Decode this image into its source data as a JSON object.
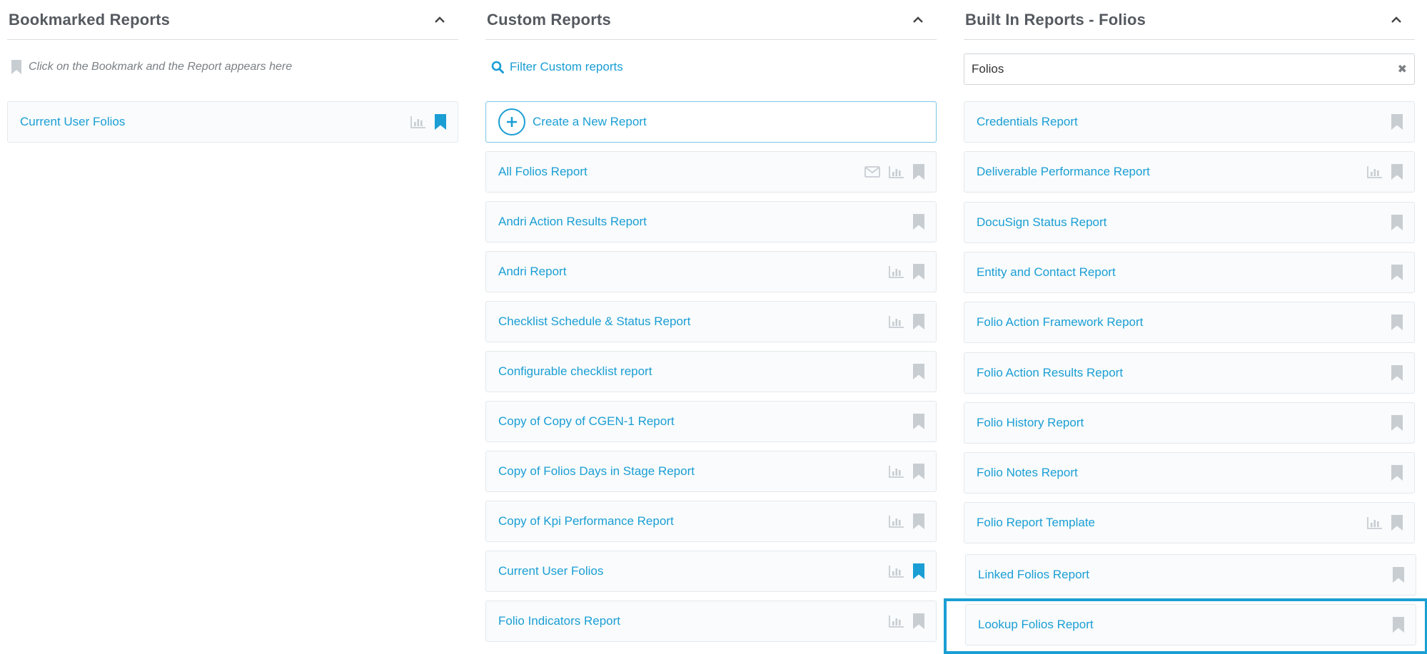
{
  "bookmarked": {
    "title": "Bookmarked Reports",
    "hint": "Click on the Bookmark and the Report appears here",
    "items": [
      {
        "label": "Current User Folios",
        "chart": true,
        "email": false,
        "bookmarked": true
      }
    ]
  },
  "custom": {
    "title": "Custom Reports",
    "filter_label": "Filter Custom reports",
    "create_label": "Create a New Report",
    "items": [
      {
        "label": "All Folios Report",
        "chart": true,
        "email": true,
        "bookmarked": false
      },
      {
        "label": "Andri Action Results Report",
        "chart": false,
        "email": false,
        "bookmarked": false
      },
      {
        "label": "Andri Report",
        "chart": true,
        "email": false,
        "bookmarked": false
      },
      {
        "label": "Checklist Schedule & Status Report",
        "chart": true,
        "email": false,
        "bookmarked": false
      },
      {
        "label": "Configurable checklist report",
        "chart": false,
        "email": false,
        "bookmarked": false
      },
      {
        "label": "Copy of Copy of CGEN-1 Report",
        "chart": false,
        "email": false,
        "bookmarked": false
      },
      {
        "label": "Copy of Folios Days in Stage Report",
        "chart": true,
        "email": false,
        "bookmarked": false
      },
      {
        "label": "Copy of Kpi Performance Report",
        "chart": true,
        "email": false,
        "bookmarked": false
      },
      {
        "label": "Current User Folios",
        "chart": true,
        "email": false,
        "bookmarked": true
      },
      {
        "label": "Folio Indicators Report",
        "chart": true,
        "email": false,
        "bookmarked": false
      }
    ]
  },
  "builtin": {
    "title": "Built In Reports - Folios",
    "search_value": "Folios",
    "items": [
      {
        "label": "Credentials Report",
        "chart": false,
        "email": false,
        "bookmarked": false
      },
      {
        "label": "Deliverable Performance Report",
        "chart": true,
        "email": false,
        "bookmarked": false
      },
      {
        "label": "DocuSign Status Report",
        "chart": false,
        "email": false,
        "bookmarked": false
      },
      {
        "label": "Entity and Contact Report",
        "chart": false,
        "email": false,
        "bookmarked": false
      },
      {
        "label": "Folio Action Framework Report",
        "chart": false,
        "email": false,
        "bookmarked": false
      },
      {
        "label": "Folio Action Results Report",
        "chart": false,
        "email": false,
        "bookmarked": false
      },
      {
        "label": "Folio History Report",
        "chart": false,
        "email": false,
        "bookmarked": false
      },
      {
        "label": "Folio Notes Report",
        "chart": false,
        "email": false,
        "bookmarked": false
      },
      {
        "label": "Folio Report Template",
        "chart": true,
        "email": false,
        "bookmarked": false
      },
      {
        "label": "Linked Folios Report",
        "chart": false,
        "email": false,
        "bookmarked": false
      },
      {
        "label": "Lookup Folios Report",
        "chart": false,
        "email": false,
        "bookmarked": false
      }
    ]
  },
  "colors": {
    "accent": "#1a9ed4",
    "icon_muted": "#c8cdd2",
    "highlight": "#1a9ed4"
  }
}
